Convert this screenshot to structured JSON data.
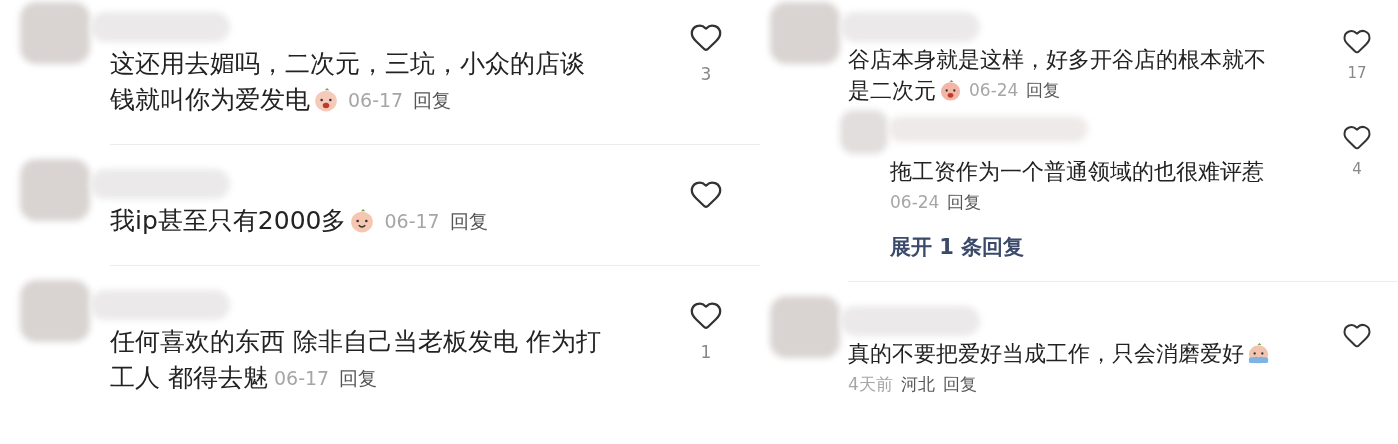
{
  "left_column": {
    "comments": [
      {
        "lines": [
          "这还用去媚吗，二次元，三坑，小众的店谈",
          "钱就叫你为爱发电"
        ],
        "emoji": true,
        "date": "06-17",
        "reply": "回复",
        "likes": "3"
      },
      {
        "lines": [
          "我ip甚至只有2000多"
        ],
        "emoji": true,
        "date": "06-17",
        "reply": "回复"
      },
      {
        "lines": [
          "任何喜欢的东西 除非自己当老板发电 作为打",
          "工人 都得去魅"
        ],
        "emoji": false,
        "date": "06-17",
        "reply": "回复",
        "likes": "1"
      }
    ]
  },
  "right_column": {
    "comments": [
      {
        "lines": [
          "谷店本身就是这样，好多开谷店的根本就不",
          "是二次元"
        ],
        "emoji": true,
        "date": "06-24",
        "reply": "回复",
        "likes": "17",
        "replies": [
          {
            "lines": [
              "拖工资作为一个普通领域的也很难评惹"
            ],
            "emoji": false,
            "date": "06-24",
            "reply": "回复",
            "likes": "4",
            "meta_below": true
          }
        ],
        "expand": "展开 1 条回复"
      },
      {
        "lines": [
          "真的不要把爱好当成工作，只会消磨爱好"
        ],
        "emoji": true,
        "date": "4天前",
        "location": "河北",
        "reply": "回复",
        "meta_below": true
      }
    ]
  }
}
